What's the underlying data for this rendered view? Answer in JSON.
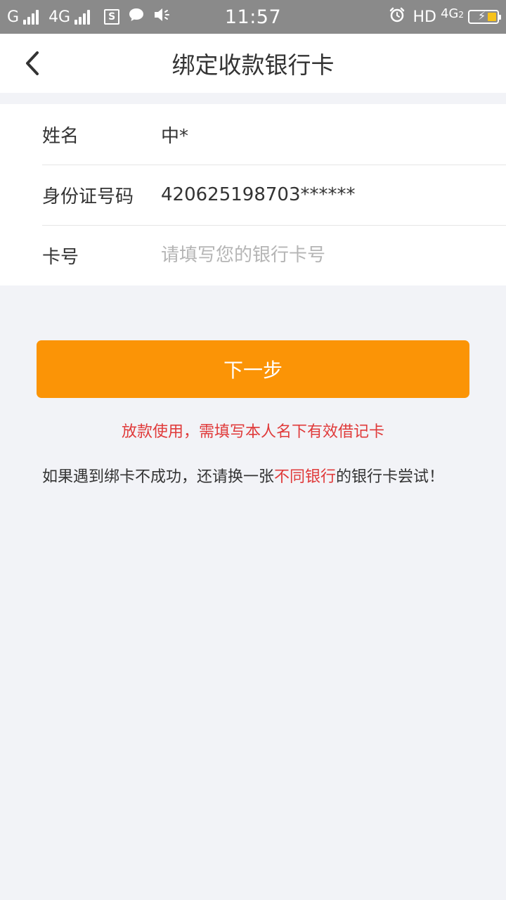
{
  "status_bar": {
    "carrier1": "G",
    "carrier2": "4G",
    "time": "11:57",
    "network_right": "HD",
    "network_right2": "4G",
    "sim_index": "2",
    "s_icon_letter": "S"
  },
  "nav": {
    "title": "绑定收款银行卡"
  },
  "form": {
    "name_label": "姓名",
    "name_value": "中*",
    "id_label": "身份证号码",
    "id_value": "420625198703******",
    "card_label": "卡号",
    "card_placeholder": "请填写您的银行卡号",
    "card_value": ""
  },
  "actions": {
    "next_label": "下一步"
  },
  "notices": {
    "warning": "放款使用，需填写本人名下有效借记卡",
    "tip_prefix": "如果遇到绑卡不成功，还请换一张",
    "tip_highlight": "不同银行",
    "tip_suffix": "的银行卡尝试！"
  },
  "colors": {
    "accent": "#fb9406",
    "warning_text": "#e03a3a",
    "page_bg": "#f2f3f7"
  },
  "icons": [
    "signal-icon",
    "sim-s-icon",
    "message-icon",
    "volume-icon",
    "alarm-icon",
    "battery-icon",
    "back-chevron-icon"
  ]
}
